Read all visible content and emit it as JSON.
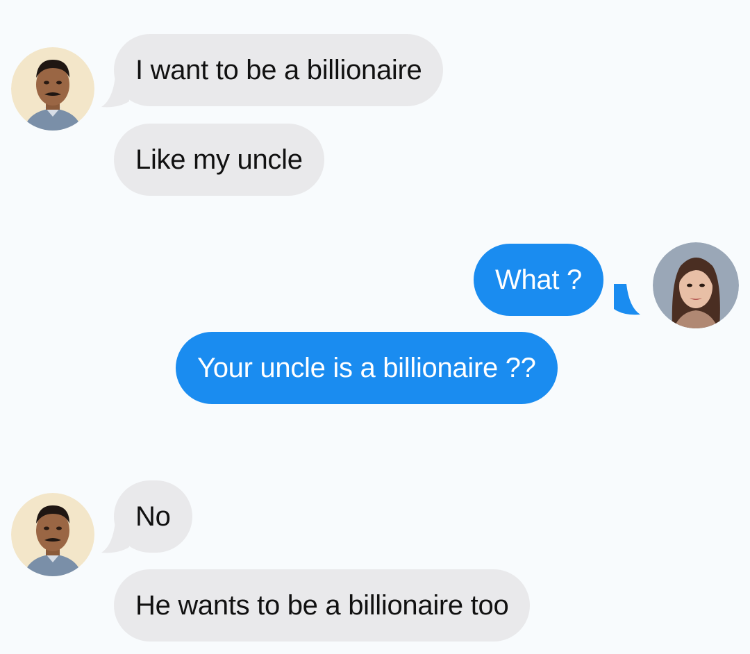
{
  "conversation": {
    "messages": [
      {
        "sender": "uncle",
        "text": "I want to be a billionaire"
      },
      {
        "sender": "uncle",
        "text": "Like my uncle"
      },
      {
        "sender": "woman",
        "text": "What ?"
      },
      {
        "sender": "woman",
        "text": "Your uncle is a billionaire ??"
      },
      {
        "sender": "uncle",
        "text": "No"
      },
      {
        "sender": "uncle",
        "text": "He wants to be a billionaire too"
      }
    ]
  },
  "colors": {
    "background": "#f8fbfd",
    "incoming_bubble": "#e9e9eb",
    "outgoing_bubble": "#1a8cf0",
    "incoming_text": "#111111",
    "outgoing_text": "#ffffff"
  },
  "icons": {
    "uncle_avatar": "man-avatar-icon",
    "woman_avatar": "woman-avatar-icon"
  }
}
